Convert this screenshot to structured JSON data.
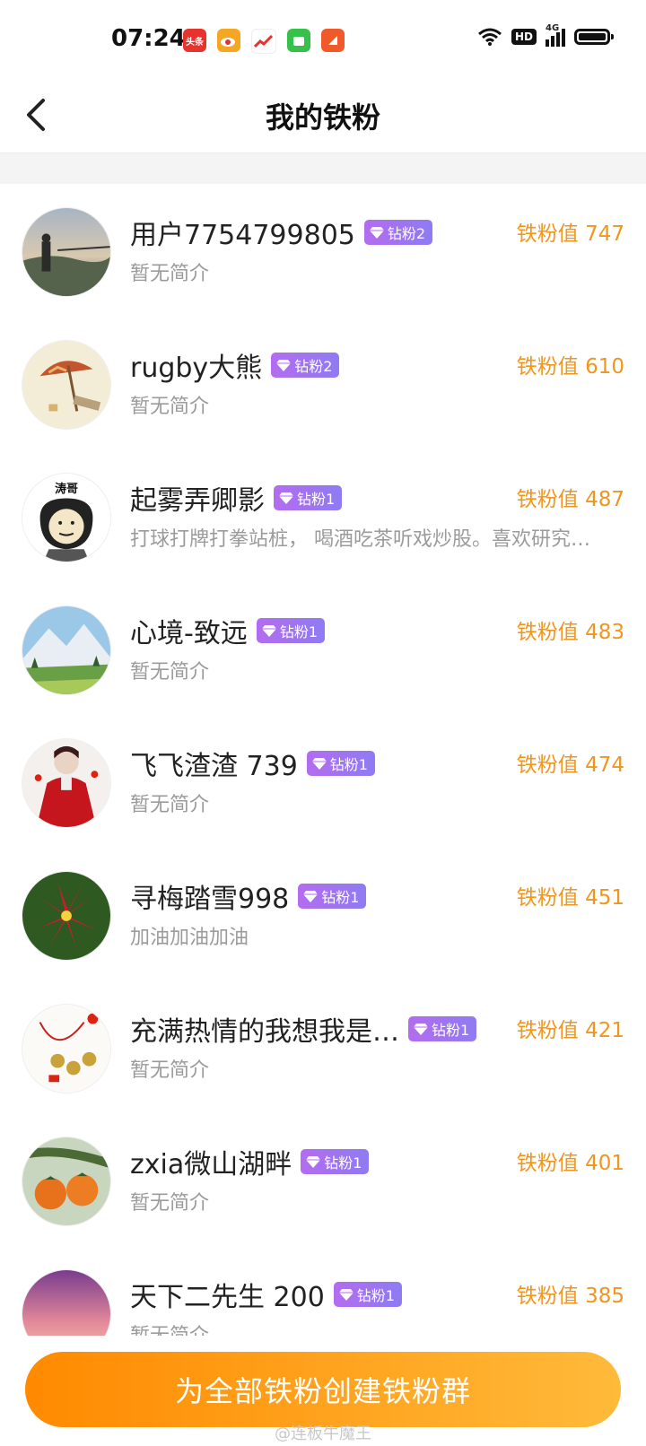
{
  "status_bar": {
    "time": "07:24",
    "apps": [
      {
        "icon": "toutiao-icon",
        "text": "头条",
        "color": "#e8322e"
      },
      {
        "icon": "weibo-icon",
        "text": "",
        "color": "#f5a623"
      },
      {
        "icon": "stock-icon",
        "text": "",
        "color": "#ffffff"
      },
      {
        "icon": "green-app-icon",
        "text": "",
        "color": "#36c24a"
      },
      {
        "icon": "orange-app-icon",
        "text": "",
        "color": "#f0592a"
      }
    ],
    "hd": "HD",
    "network": "4G",
    "battery_level": 0.95
  },
  "header": {
    "title": "我的铁粉"
  },
  "fans": [
    {
      "name": "用户7754799805",
      "badge": "钻粉2",
      "score": "铁粉值 747",
      "bio": "暂无简介",
      "avatar": "landscape-avatar"
    },
    {
      "name": "rugby大熊",
      "badge": "钻粉2",
      "score": "铁粉值 610",
      "bio": "暂无简介",
      "avatar": "beach-umbrella-avatar"
    },
    {
      "name": "起雾弄卿影",
      "badge": "钻粉1",
      "score": "铁粉值 487",
      "bio": "打球打牌打拳站桩， 喝酒吃茶听戏炒股。喜欢研究…",
      "avatar": "meme-face-avatar",
      "avatar_text": "涛哥"
    },
    {
      "name": "心境-致远",
      "badge": "钻粉1",
      "score": "铁粉值 483",
      "bio": "暂无简介",
      "avatar": "mountain-avatar"
    },
    {
      "name": "飞飞渣渣 739",
      "badge": "钻粉1",
      "score": "铁粉值 474",
      "bio": "暂无简介",
      "avatar": "red-dress-avatar"
    },
    {
      "name": "寻梅踏雪998",
      "badge": "钻粉1",
      "score": "铁粉值 451",
      "bio": "加油加油加油",
      "avatar": "red-flower-avatar"
    },
    {
      "name": "充满热情的我想我是…",
      "badge": "钻粉1",
      "score": "铁粉值 421",
      "bio": "暂无简介",
      "avatar": "coins-avatar"
    },
    {
      "name": "zxia微山湖畔",
      "badge": "钻粉1",
      "score": "铁粉值 401",
      "bio": "暂无简介",
      "avatar": "persimmon-avatar"
    },
    {
      "name": "天下二先生 200",
      "badge": "钻粉1",
      "score": "铁粉值 385",
      "bio": "暂无简介",
      "avatar": "sunset-avatar"
    }
  ],
  "bottom": {
    "create_group_label": "为全部铁粉创建铁粉群",
    "watermark": "@连板牛魔王"
  }
}
